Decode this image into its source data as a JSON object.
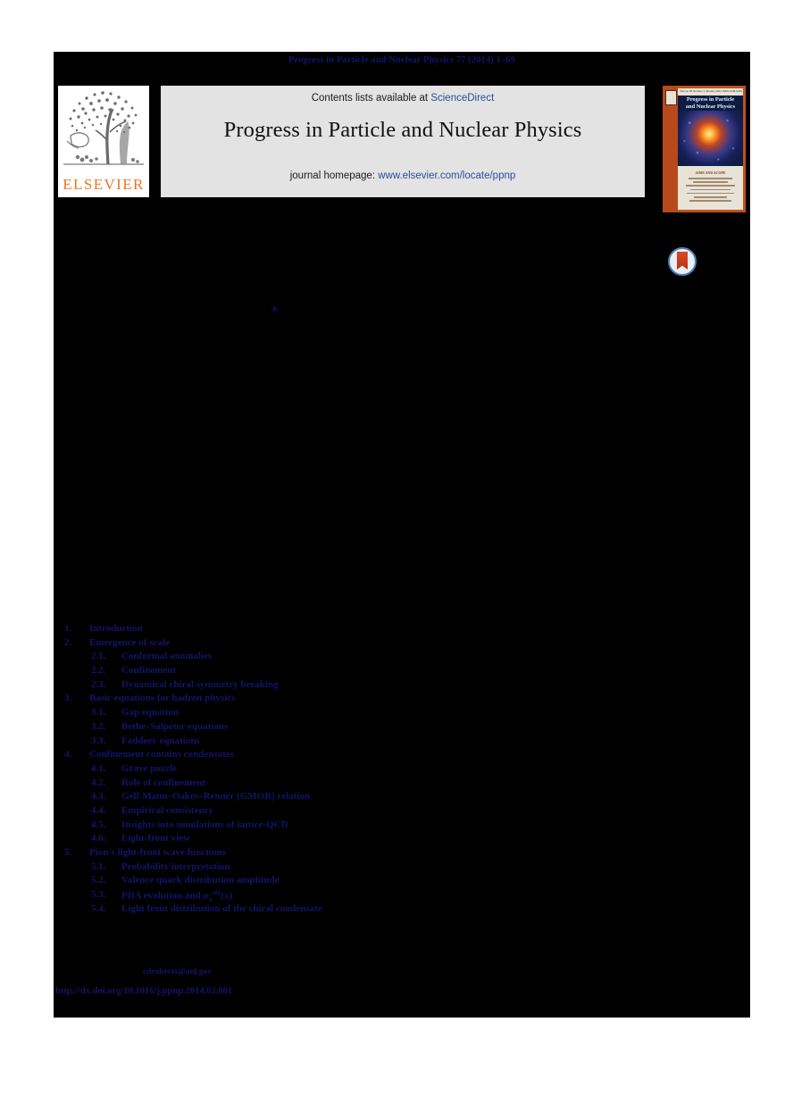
{
  "running_head": "Progress in Particle and Nuclear Physics 77 (2014) 1–69",
  "masthead": {
    "publisher_name": "ELSEVIER",
    "contents_prefix": "Contents lists available at ",
    "contents_link": "ScienceDirect",
    "journal_title": "Progress in Particle and Nuclear Physics",
    "homepage_prefix": "journal homepage: ",
    "homepage_link": "www.elsevier.com/locate/ppnp",
    "cover": {
      "masthead_small": "Volume 66  Number 1  January 2011                    ISSN 0146-6410",
      "title_line1": "Progress in Particle",
      "title_line2": "and Nuclear Physics",
      "lower_heading": "AIMS AND SCOPE"
    }
  },
  "badges": {
    "crossmark_label": "CrossMark"
  },
  "footnote_marker": "✳",
  "toc": [
    {
      "level": 1,
      "number": "1.",
      "label": "Introduction"
    },
    {
      "level": 1,
      "number": "2.",
      "label": "Emergence of scale"
    },
    {
      "level": 2,
      "number": "2.1.",
      "label": "Conformal anomalies"
    },
    {
      "level": 2,
      "number": "2.2.",
      "label": "Confinement"
    },
    {
      "level": 2,
      "number": "2.3.",
      "label": "Dynamical chiral symmetry breaking"
    },
    {
      "level": 1,
      "number": "3.",
      "label": "Basic equations for hadron physics"
    },
    {
      "level": 2,
      "number": "3.1.",
      "label": "Gap equation"
    },
    {
      "level": 2,
      "number": "3.2.",
      "label": "Bethe–Salpeter equations"
    },
    {
      "level": 2,
      "number": "3.3.",
      "label": "Faddeev equations"
    },
    {
      "level": 1,
      "number": "4.",
      "label": "Confinement contains condensates"
    },
    {
      "level": 2,
      "number": "4.1.",
      "label": "Grave puzzle"
    },
    {
      "level": 2,
      "number": "4.2.",
      "label": "Role of confinement"
    },
    {
      "level": 2,
      "number": "4.3.",
      "label": "Gell-Mann–Oakes–Renner (GMOR) relation"
    },
    {
      "level": 2,
      "number": "4.4.",
      "label": "Empirical consistency"
    },
    {
      "level": 2,
      "number": "4.5.",
      "label": "Insights into simulations of lattice-QCD"
    },
    {
      "level": 2,
      "number": "4.6.",
      "label": "Light-front view"
    },
    {
      "level": 1,
      "number": "5.",
      "label": "Pion's light-front wave functions"
    },
    {
      "level": 2,
      "number": "5.1.",
      "label": "Probability interpretation"
    },
    {
      "level": 2,
      "number": "5.2.",
      "label": "Valence quark distribution amplitude"
    },
    {
      "level": 2,
      "number": "5.3.",
      "label": "PDA evolution and φπasy(x)",
      "html": "PDA evolution and <span class=\"var\">φ</span><sub>π</sub><sup>asy</sup>(<span class=\"var\">x</span>)"
    },
    {
      "level": 2,
      "number": "5.4.",
      "label": "Light front distribution of the chiral condensate"
    }
  ],
  "footer": {
    "corresponding_email": "cdroberts@anl.gov",
    "doi_url": "http://dx.doi.org/10.1016/j.ppnp.2014.02.001"
  },
  "colors": {
    "page_background": "#000000",
    "outer_background": "#ffffff",
    "link_blue": "#13136b",
    "elsevier_orange": "#e87722",
    "sciencedirect_blue": "#2b4b9b",
    "masthead_grey": "#e3e3e3",
    "cover_orange": "#c0501e"
  }
}
